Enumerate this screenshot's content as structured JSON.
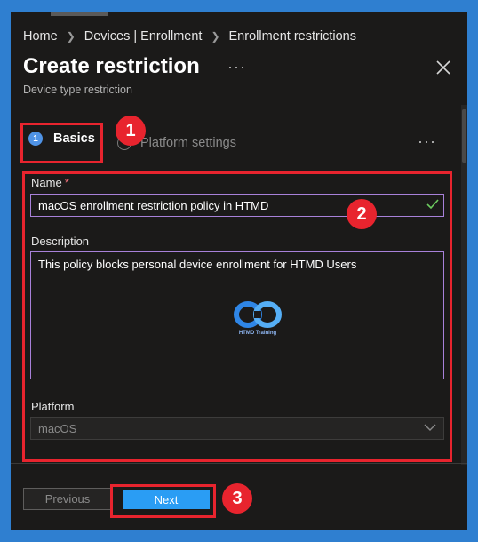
{
  "breadcrumb": [
    "Home",
    "Devices | Enrollment",
    "Enrollment restrictions"
  ],
  "header": {
    "title": "Create restriction",
    "subtitle": "Device type restriction",
    "more": "···"
  },
  "tabs": [
    {
      "label": "Basics",
      "number": "1",
      "active": true
    },
    {
      "label": "Platform settings",
      "active": false
    }
  ],
  "tabs_more": "···",
  "form": {
    "name_label": "Name",
    "required_mark": "*",
    "name_value": "macOS enrollment restriction policy in HTMD",
    "description_label": "Description",
    "description_value": "This policy blocks personal device enrollment for HTMD Users",
    "platform_label": "Platform",
    "platform_value": "macOS"
  },
  "watermark": {
    "text": "HTMD Training"
  },
  "footer": {
    "previous_label": "Previous",
    "next_label": "Next"
  },
  "annotations": {
    "badge1": "1",
    "badge2": "2",
    "badge3": "3"
  },
  "colors": {
    "panel_bg": "#1b1a19",
    "frame_bg": "#2f7fd0",
    "accent": "#2a9df4",
    "input_border": "#a881d9",
    "annotation_red": "#e8242e",
    "valid_green": "#6ccb5f"
  },
  "icons": {
    "close": "close-icon",
    "check": "check-icon",
    "dropdown": "chevron-down-icon",
    "info": "info-icon"
  }
}
